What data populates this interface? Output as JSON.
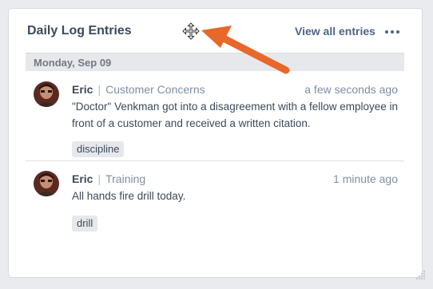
{
  "widget": {
    "title": "Daily Log Entries",
    "view_all_label": "View all entries",
    "more_icon": "ellipsis-horizontal-icon",
    "move_icon": "move-cursor-icon"
  },
  "date_group": {
    "label": "Monday, Sep 09"
  },
  "entries": [
    {
      "author": "Eric",
      "separator": "|",
      "category": "Customer Concerns",
      "time": "a few seconds ago",
      "text": "\"Doctor\" Venkman got into a disagreement with a fellow employee in front of a customer and received a written citation.",
      "tag": "discipline"
    },
    {
      "author": "Eric",
      "separator": "|",
      "category": "Training",
      "time": "1 minute ago",
      "text": "All hands fire drill today.",
      "tag": "drill"
    }
  ],
  "colors": {
    "accent": "#4d6584",
    "arrow": "#e8672b",
    "card_bg": "#ffffff",
    "page_bg": "#e9ebee"
  }
}
